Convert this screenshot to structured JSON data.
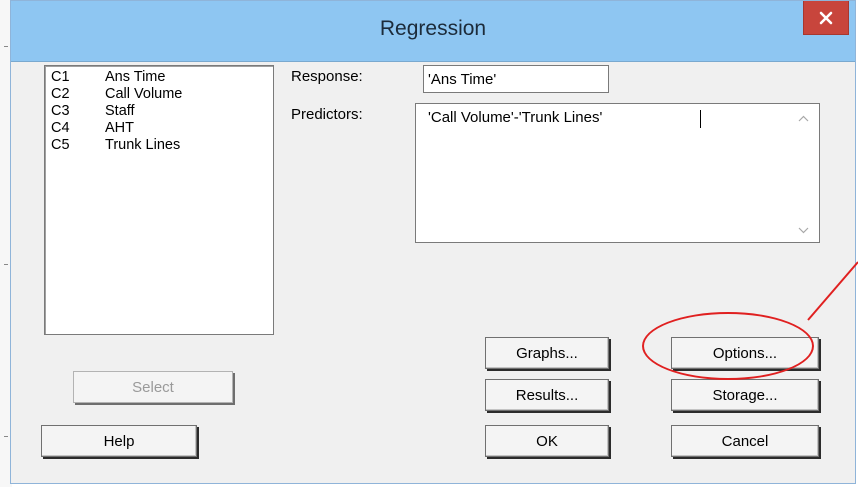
{
  "window": {
    "title": "Regression"
  },
  "variables": [
    {
      "code": "C1",
      "name": "Ans Time"
    },
    {
      "code": "C2",
      "name": "Call Volume"
    },
    {
      "code": "C3",
      "name": "Staff"
    },
    {
      "code": "C4",
      "name": "AHT"
    },
    {
      "code": "C5",
      "name": "Trunk Lines"
    }
  ],
  "response": {
    "label": "Response:",
    "value": "'Ans Time'"
  },
  "predictors": {
    "label": "Predictors:",
    "value": "'Call Volume'-'Trunk Lines'"
  },
  "buttons": {
    "select": "Select",
    "help": "Help",
    "graphs": "Graphs...",
    "options": "Options...",
    "results": "Results...",
    "storage": "Storage...",
    "ok": "OK",
    "cancel": "Cancel"
  },
  "colors": {
    "titlebar": "#8ec6f2",
    "close": "#c8453c",
    "annotation": "#e02020"
  },
  "icons": {
    "close": "close-icon",
    "scroll_up": "chevron-up-icon",
    "scroll_down": "chevron-down-icon"
  }
}
